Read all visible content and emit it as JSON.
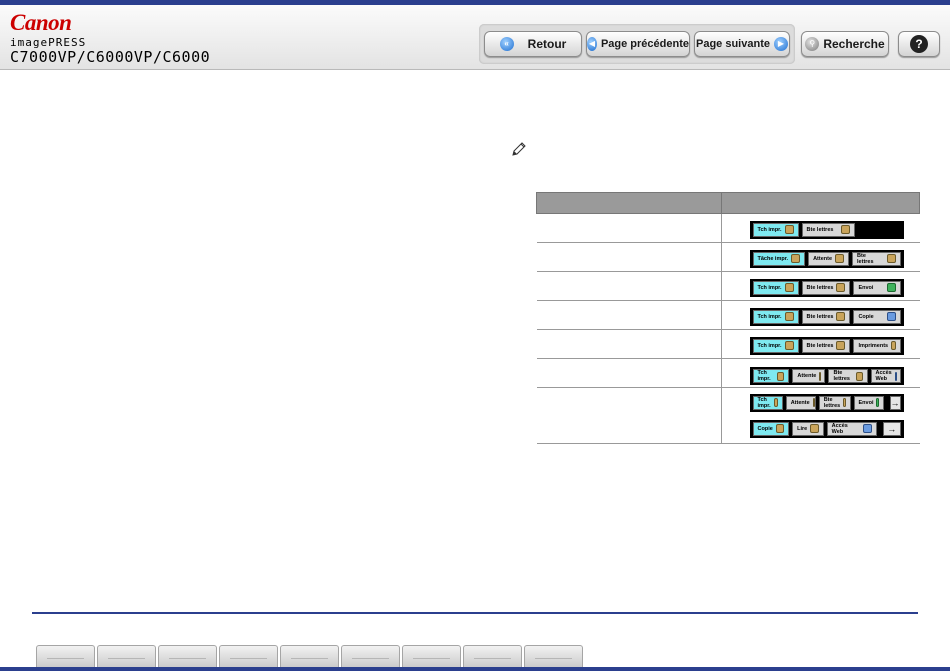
{
  "brand": {
    "logo": "Canon",
    "series": "imagePRESS",
    "model": "C7000VP/C6000VP/C6000"
  },
  "toolbar": {
    "retour": "Retour",
    "prev": "Page précédente",
    "next": "Page suivante",
    "search": "Recherche",
    "help": "?"
  },
  "table": {
    "rows": [
      {
        "buttons": [
          {
            "label": "Tch impr.",
            "style": "cyan"
          },
          {
            "label": "Bte lettres",
            "style": "grey"
          }
        ]
      },
      {
        "buttons": [
          {
            "label": "Tâche impr.",
            "style": "cyan"
          },
          {
            "label": "Attente",
            "style": "grey"
          },
          {
            "label": "Bte lettres",
            "style": "grey"
          }
        ]
      },
      {
        "buttons": [
          {
            "label": "Tch impr.",
            "style": "cyan"
          },
          {
            "label": "Bte lettres",
            "style": "grey"
          },
          {
            "label": "Envoi",
            "style": "grey"
          }
        ]
      },
      {
        "buttons": [
          {
            "label": "Tch impr.",
            "style": "cyan"
          },
          {
            "label": "Bte lettres",
            "style": "grey"
          },
          {
            "label": "Copie",
            "style": "grey"
          }
        ]
      },
      {
        "buttons": [
          {
            "label": "Tch impr.",
            "style": "cyan"
          },
          {
            "label": "Bte lettres",
            "style": "grey"
          },
          {
            "label": "Impriments",
            "style": "grey"
          }
        ]
      },
      {
        "buttons": [
          {
            "label": "Tch impr.",
            "style": "cyan"
          },
          {
            "label": "Attente",
            "style": "grey"
          },
          {
            "label": "Bte lettres",
            "style": "grey"
          },
          {
            "label": "Accès Web",
            "style": "grey"
          }
        ]
      }
    ],
    "last_row": {
      "line1": [
        "Tch impr.",
        "Attente",
        "Bte lettres",
        "Envoi"
      ],
      "line2": [
        "Copie",
        "Lire",
        "Accès Web"
      ],
      "arrow": "→"
    }
  }
}
